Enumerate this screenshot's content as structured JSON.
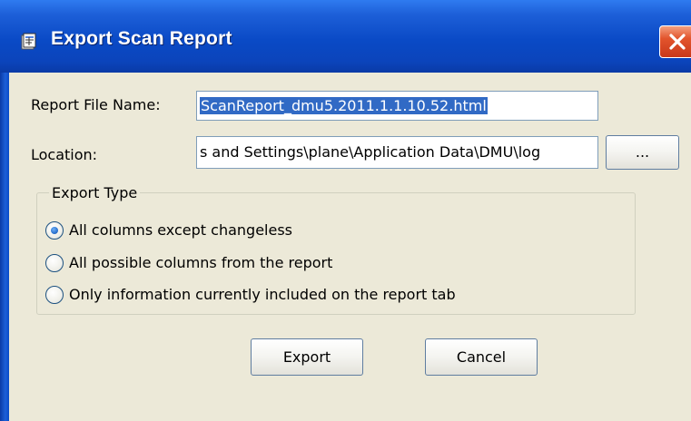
{
  "window": {
    "title": "Export Scan Report",
    "title_icon": "dialog-app-icon",
    "close_icon": "close-x-icon"
  },
  "form": {
    "report_file_name_label": "Report File Name:",
    "report_file_name_value": "ScanReport_dmu5.2011.1.1.10.52.html",
    "location_label": "Location:",
    "location_value": "s and Settings\\plane\\Application Data\\DMU\\log",
    "browse_label": "..."
  },
  "export_type": {
    "title": "Export Type",
    "options": [
      {
        "label": "All columns except changeless",
        "selected": true
      },
      {
        "label": "All possible columns from the report",
        "selected": false
      },
      {
        "label": "Only information currently included on the report tab",
        "selected": false
      }
    ]
  },
  "buttons": {
    "export": "Export",
    "cancel": "Cancel"
  },
  "colors": {
    "titlebar": "#0a4ac6",
    "dialog_bg": "#ece9d8",
    "selection": "#316ac5",
    "close": "#e2542c"
  }
}
